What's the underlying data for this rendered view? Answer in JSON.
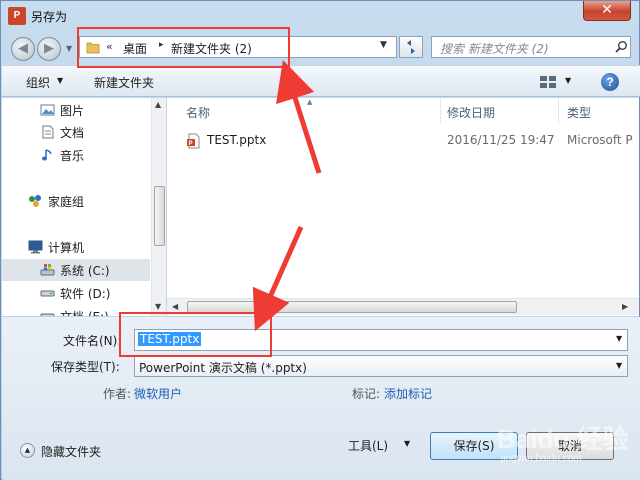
{
  "window": {
    "title": "另存为",
    "app_icon_text": "P",
    "close_glyph": "✕"
  },
  "address_bar": {
    "prefix": "«",
    "segments": [
      "桌面",
      "新建文件夹 (2)"
    ],
    "separator": "▸"
  },
  "search": {
    "placeholder": "搜索 新建文件夹 (2)"
  },
  "toolbar": {
    "organize_label": "组织",
    "new_folder_label": "新建文件夹",
    "help_glyph": "?"
  },
  "nav_pane": {
    "items": [
      {
        "label": "图片",
        "icon": "pictures-icon"
      },
      {
        "label": "文档",
        "icon": "documents-icon"
      },
      {
        "label": "音乐",
        "icon": "music-icon"
      },
      {
        "label": "家庭组",
        "icon": "homegroup-icon"
      },
      {
        "label": "计算机",
        "icon": "computer-icon"
      },
      {
        "label": "系统 (C:)",
        "icon": "system-drive-icon",
        "selected": true
      },
      {
        "label": "软件 (D:)",
        "icon": "drive-icon"
      },
      {
        "label": "文档 (E:)",
        "icon": "drive-icon"
      }
    ]
  },
  "file_list": {
    "columns": [
      "名称",
      "修改日期",
      "类型"
    ],
    "rows": [
      {
        "name": "TEST.pptx",
        "modified": "2016/11/25 19:47",
        "type": "Microsoft P"
      }
    ]
  },
  "form": {
    "filename_label": "文件名(N):",
    "filename_value": "TEST.pptx",
    "filetype_label": "保存类型(T):",
    "filetype_value": "PowerPoint 演示文稿 (*.pptx)",
    "author_label": "作者:",
    "author_value": "微软用户",
    "tags_label": "标记:",
    "tags_value": "添加标记",
    "hide_folders_label": "隐藏文件夹",
    "tools_label": "工具(L)",
    "save_label": "保存(S)",
    "cancel_label": "取消"
  },
  "watermark": {
    "text": "Baidu 经验",
    "sub": "jingyan.baidu.com"
  },
  "colors": {
    "annotation": "#ee3b33",
    "selection": "#3399ff",
    "link": "#1e5fb4"
  }
}
